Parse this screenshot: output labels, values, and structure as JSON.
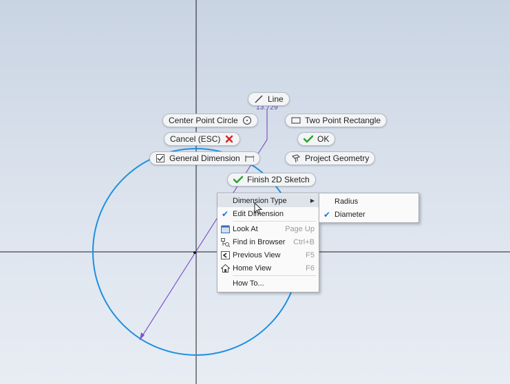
{
  "sketch": {
    "dimension_value": "13.729",
    "colors": {
      "circle": "#1d8fe0",
      "dimension_line": "#7e55c8",
      "axis": "#1a1a1a",
      "check_green": "#2aa52a",
      "cancel_red": "#e02020"
    }
  },
  "marking_menu": {
    "line_label": "Line",
    "center_point_circle_label": "Center Point Circle",
    "two_point_rectangle_label": "Two Point Rectangle",
    "cancel_label": "Cancel (ESC)",
    "ok_label": "OK",
    "general_dimension_label": "General Dimension",
    "project_geometry_label": "Project Geometry",
    "finish_sketch_label": "Finish 2D Sketch"
  },
  "context_menu": {
    "dimension_type": "Dimension Type",
    "edit_dimension": "Edit Dimension",
    "look_at": "Look At",
    "look_at_shortcut": "Page Up",
    "find_in_browser": "Find in Browser",
    "find_in_browser_shortcut": "Ctrl+B",
    "previous_view": "Previous View",
    "previous_view_shortcut": "F5",
    "home_view": "Home View",
    "home_view_shortcut": "F6",
    "how_to": "How To..."
  },
  "submenu": {
    "radius": "Radius",
    "diameter": "Diameter",
    "selected": "Diameter"
  }
}
